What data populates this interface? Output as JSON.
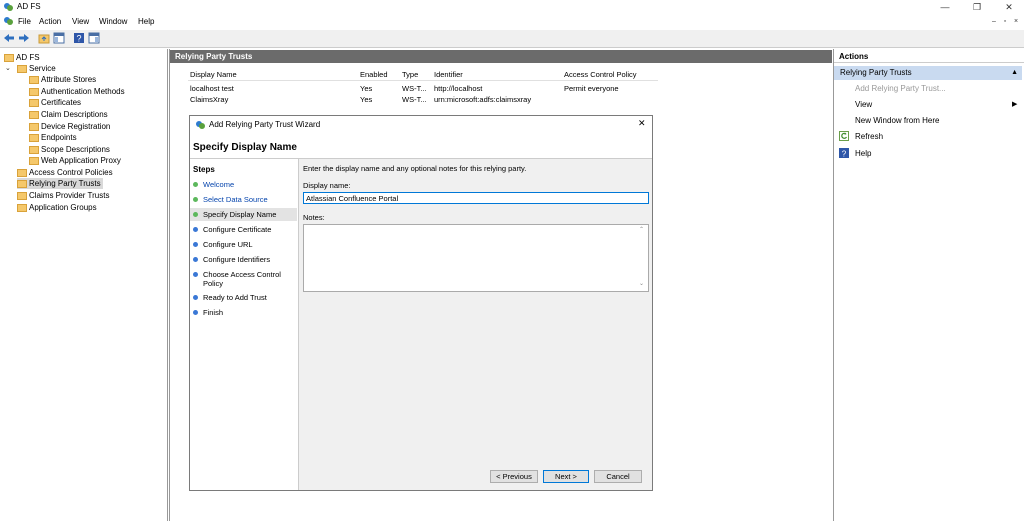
{
  "window": {
    "title": "AD FS",
    "minimize": "—",
    "maximize": "❐",
    "close": "✕"
  },
  "menu": {
    "items": [
      "File",
      "Action",
      "View",
      "Window",
      "Help"
    ],
    "mdi_min": "–",
    "mdi_restore": "▫",
    "mdi_close": "×"
  },
  "tree": {
    "root": "AD FS",
    "service": "Service",
    "children": [
      "Attribute Stores",
      "Authentication Methods",
      "Certificates",
      "Claim Descriptions",
      "Device Registration",
      "Endpoints",
      "Scope Descriptions",
      "Web Application Proxy"
    ],
    "others": [
      "Access Control Policies",
      "Relying Party Trusts",
      "Claims Provider Trusts",
      "Application Groups"
    ]
  },
  "center": {
    "header": "Relying Party Trusts",
    "columns": [
      "Display Name",
      "Enabled",
      "Type",
      "Identifier",
      "Access Control Policy"
    ],
    "rows": [
      [
        "localhost test",
        "Yes",
        "WS-T...",
        "http://localhost",
        "Permit everyone"
      ],
      [
        "ClaimsXray",
        "Yes",
        "WS-T...",
        "urn:microsoft:adfs:claimsxray",
        ""
      ]
    ]
  },
  "actions": {
    "header": "Actions",
    "group": "Relying Party Trusts",
    "items": [
      "Add Relying Party Trust...",
      "View",
      "New Window from Here",
      "Refresh",
      "Help"
    ]
  },
  "wizard": {
    "title": "Add Relying Party Trust Wizard",
    "close": "✕",
    "heading": "Specify Display Name",
    "steps_label": "Steps",
    "steps": [
      "Welcome",
      "Select Data Source",
      "Specify Display Name",
      "Configure Certificate",
      "Configure URL",
      "Configure Identifiers",
      "Choose Access Control Policy",
      "Ready to Add Trust",
      "Finish"
    ],
    "instruction": "Enter the display name and any optional notes for this relying party.",
    "display_name_label": "Display name:",
    "display_name_value": "Atlassian Confluence Portal",
    "notes_label": "Notes:",
    "notes_value": "",
    "buttons": {
      "previous": "< Previous",
      "next": "Next >",
      "cancel": "Cancel"
    }
  },
  "colors": {
    "header_bar": "#6b6b6b",
    "selection": "#c9daf0",
    "step_done": "#5cb85c",
    "step_pending": "#3a78d6",
    "link": "#0645ad"
  }
}
